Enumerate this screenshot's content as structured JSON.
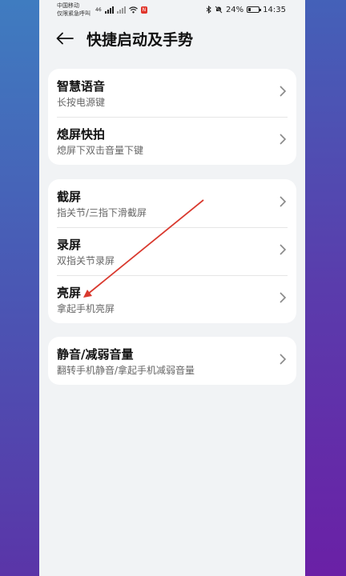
{
  "status_bar": {
    "carrier_line1": "中国移动",
    "carrier_line2": "仅限紧急呼叫",
    "network": "46",
    "battery_percent": "24%",
    "time": "14:35"
  },
  "header": {
    "title": "快捷启动及手势"
  },
  "groups": [
    {
      "items": [
        {
          "title": "智慧语音",
          "subtitle": "长按电源键"
        },
        {
          "title": "熄屏快拍",
          "subtitle": "熄屏下双击音量下键"
        }
      ]
    },
    {
      "items": [
        {
          "title": "截屏",
          "subtitle": "指关节/三指下滑截屏"
        },
        {
          "title": "录屏",
          "subtitle": "双指关节录屏"
        },
        {
          "title": "亮屏",
          "subtitle": "拿起手机亮屏"
        }
      ]
    },
    {
      "items": [
        {
          "title": "静音/减弱音量",
          "subtitle": "翻转手机静音/拿起手机减弱音量"
        }
      ]
    }
  ],
  "annotation_color": "#d9392e"
}
